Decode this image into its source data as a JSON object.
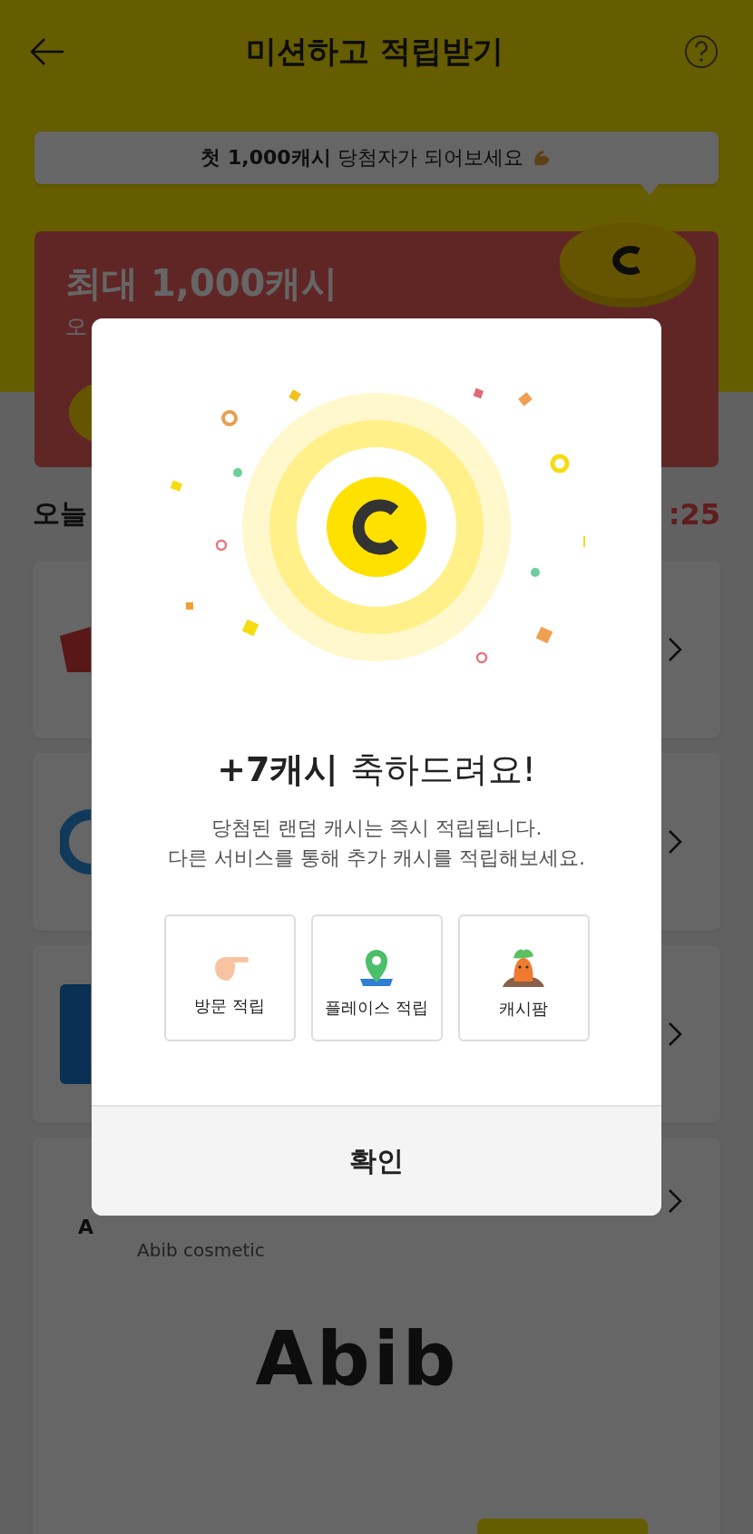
{
  "header": {
    "title": "미션하고 적립받기"
  },
  "promo_bubble": {
    "text": "**첫 1,000캐시** 당첨자가 되어보세요"
  },
  "banner": {
    "title": "최대 1,000캐시",
    "subtitle": "오"
  },
  "section": {
    "title": "오늘",
    "timer": ":25"
  },
  "cards": [
    {
      "kind": "red-logo"
    },
    {
      "kind": "ring-logo"
    },
    {
      "kind": "tile-logo"
    },
    {
      "kind": "brand",
      "logo_letter": "A",
      "name": "Abib cosmetic",
      "logo_text": "Abib"
    }
  ],
  "modal": {
    "title": "**+7캐시** 축하드려요!",
    "message": [
      "당첨된 랜덤 캐시는 즉시 적립됩니다.",
      "다른 서비스를 통해 추가 캐시를 적립해보세요."
    ],
    "shortcuts": [
      {
        "kind": "visit",
        "label": "방문 적립"
      },
      {
        "kind": "place",
        "label": "플레이스 적립"
      },
      {
        "kind": "farm",
        "label": "캐시팜"
      }
    ],
    "confirm": "확인"
  }
}
